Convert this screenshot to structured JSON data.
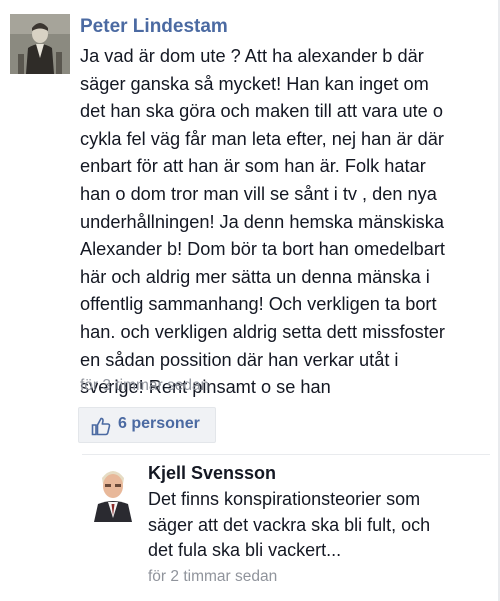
{
  "comment": {
    "author": "Peter Lindestam",
    "text": "Ja vad är dom ute ? Att ha alexander b där\nsäger ganska så mycket! Han kan inget om\ndet han ska göra och maken till att vara ute o\ncykla fel väg får man leta efter, nej han är där\nenbart för att han är som han är. Folk hatar\nhan o dom tror man vill se sånt i tv , den nya\nunderhållningen! Ja denn hemska mänskiska\nAlexander b! Dom bör ta bort han omedelbart\nhär och aldrig mer sätta un denna mänska i\noffentlig sammanhang! Och verkligen ta bort\nhan. och verkligen aldrig setta dett missfoster\nen sådan possition där han verkar utåt i\nsverige! Rent pinsamt o se han",
    "timestamp": "för 3 timmar sedan",
    "likes_label": "6 personer",
    "avatar_icon": "profile-photo-old-man-portrait"
  },
  "reply": {
    "author": "Kjell Svensson",
    "text": "Det finns konspirationsteorier som\nsäger att det vackra ska bli fult, och\ndet fula ska bli vackert...",
    "timestamp": "för 2 timmar sedan",
    "avatar_icon": "profile-photo-man-suit"
  },
  "colors": {
    "author_link": "#4b6aa2",
    "muted_text": "#90949c",
    "like_pill_bg": "#f0f2f5",
    "like_accent": "#4b6aa2"
  }
}
